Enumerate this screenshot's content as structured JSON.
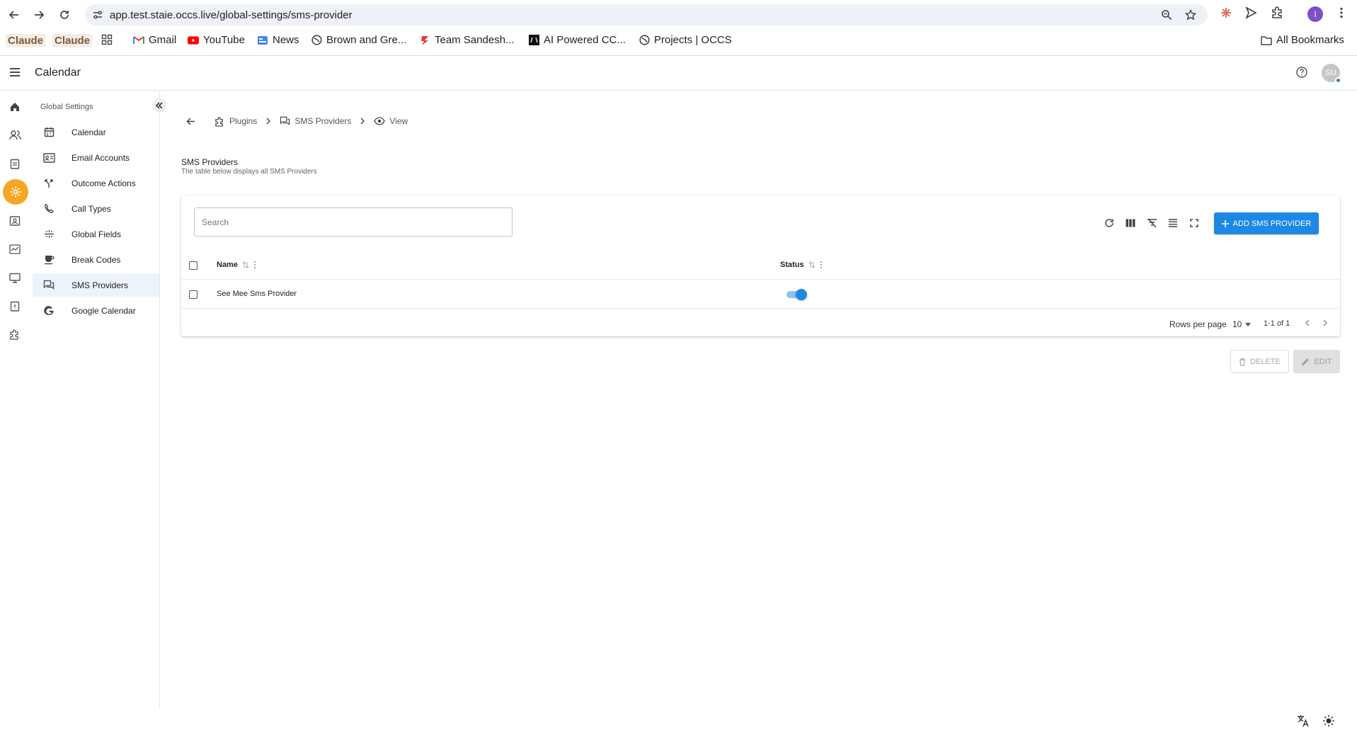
{
  "browser": {
    "url": "app.test.staie.occs.live/global-settings/sms-provider",
    "profile_initial": "I",
    "bookmarks": [
      {
        "label": "Claude",
        "icon": "claude-icon"
      },
      {
        "label": "Claude",
        "icon": "claude-icon"
      },
      {
        "label": "",
        "icon": "apps-grid-icon"
      },
      {
        "label": "Gmail",
        "icon": "gmail-icon"
      },
      {
        "label": "YouTube",
        "icon": "youtube-icon"
      },
      {
        "label": "News",
        "icon": "news-icon"
      },
      {
        "label": "Brown and Gre...",
        "icon": "globe-icon"
      },
      {
        "label": "Team Sandesh...",
        "icon": "team-icon"
      },
      {
        "label": "AI Powered CC...",
        "icon": "ai-icon"
      },
      {
        "label": "Projects | OCCS",
        "icon": "globe-icon"
      }
    ],
    "all_bookmarks": "All Bookmarks"
  },
  "header": {
    "title": "Calendar",
    "avatar_initials": "SU"
  },
  "sidebar": {
    "heading": "Global Settings",
    "items": [
      {
        "label": "Calendar",
        "icon": "calendar-icon"
      },
      {
        "label": "Email Accounts",
        "icon": "email-account-icon"
      },
      {
        "label": "Outcome Actions",
        "icon": "fork-icon"
      },
      {
        "label": "Call Types",
        "icon": "phone-icon"
      },
      {
        "label": "Global Fields",
        "icon": "fields-icon"
      },
      {
        "label": "Break Codes",
        "icon": "coffee-icon"
      },
      {
        "label": "SMS Providers",
        "icon": "chat-icon",
        "active": true
      },
      {
        "label": "Google Calendar",
        "icon": "google-icon"
      }
    ]
  },
  "breadcrumb": {
    "items": [
      {
        "label": "Plugins",
        "icon": "puzzle-icon"
      },
      {
        "label": "SMS Providers",
        "icon": "chat-icon"
      },
      {
        "label": "View",
        "icon": "eye-icon"
      }
    ]
  },
  "page": {
    "title": "SMS Providers",
    "subtitle": "The table below displays all SMS Providers"
  },
  "table": {
    "search_placeholder": "Search",
    "add_button": "ADD SMS PROVIDER",
    "columns": [
      "Name",
      "Status"
    ],
    "rows": [
      {
        "name": "See Mee Sms Provider",
        "status": true
      }
    ],
    "rows_per_page_label": "Rows per page",
    "rows_per_page": "10",
    "range": "1-1 of 1"
  },
  "actions": {
    "delete": "DELETE",
    "edit": "EDIT"
  },
  "colors": {
    "accent": "#1e88e5",
    "rail_active": "#f5a623",
    "nav_active_bg": "#ecf3fc"
  }
}
